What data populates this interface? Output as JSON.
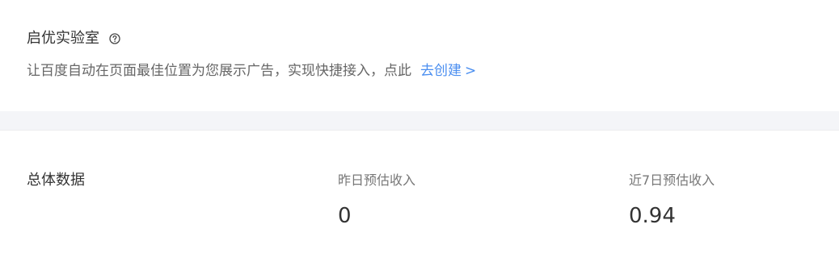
{
  "lab": {
    "title": "启优实验室",
    "help_icon": "question-circle-icon",
    "description": "让百度自动在页面最佳位置为您展示广告，实现快捷接入，点此",
    "create_link": "去创建",
    "create_link_arrow": ">"
  },
  "stats": {
    "title": "总体数据",
    "items": [
      {
        "label": "昨日预估收入",
        "value": "0"
      },
      {
        "label": "近7日预估收入",
        "value": "0.94"
      }
    ]
  },
  "colors": {
    "link": "#4a8ef0",
    "text_primary": "#333333",
    "text_secondary": "#666666",
    "divider_band": "#f4f5f8"
  }
}
